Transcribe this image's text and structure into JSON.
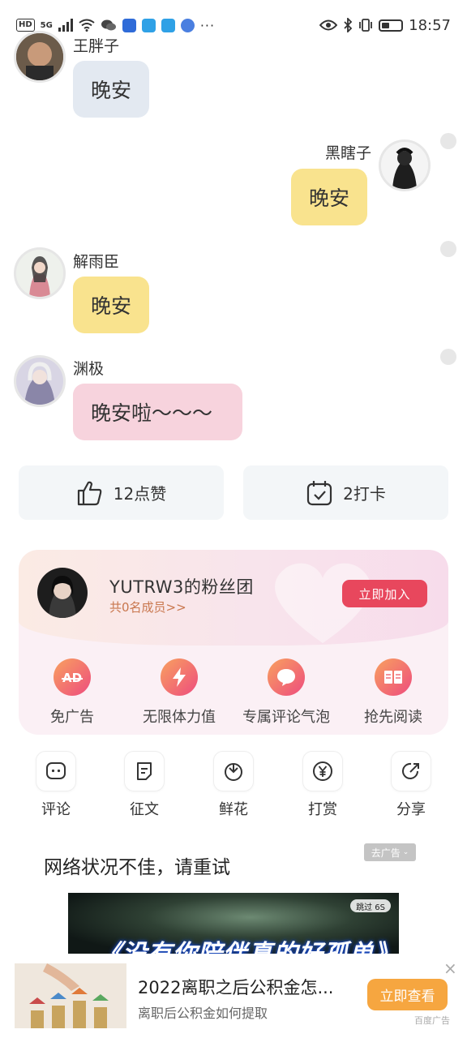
{
  "status_bar": {
    "left_chips": [
      "HD",
      "5G"
    ],
    "time": "18:57"
  },
  "chat": {
    "messages": [
      {
        "sender": "王胖子",
        "text": "晚安",
        "side": "left",
        "bubble_color": "#e3e9f1"
      },
      {
        "sender": "黑瞎子",
        "text": "晚安",
        "side": "right",
        "bubble_color": "#f9e38e"
      },
      {
        "sender": "解雨臣",
        "text": "晚安",
        "side": "left",
        "bubble_color": "#f9e38e"
      },
      {
        "sender": "渊极",
        "text": "晚安啦～～～",
        "side": "left",
        "bubble_color": "#f7d3dd"
      }
    ]
  },
  "actions": {
    "like_label": "12点赞",
    "checkin_label": "2打卡"
  },
  "fan_club": {
    "title": "YUTRW3的粉丝团",
    "members": "共0名成员>>",
    "join_label": "立即加入",
    "perks": [
      {
        "label": "免广告",
        "icon": "ad-free-icon"
      },
      {
        "label": "无限体力值",
        "icon": "lightning-icon"
      },
      {
        "label": "专属评论气泡",
        "icon": "chat-bubble-icon"
      },
      {
        "label": "抢先阅读",
        "icon": "book-icon"
      }
    ]
  },
  "toolbar": {
    "items": [
      {
        "label": "评论",
        "icon": "comment-icon"
      },
      {
        "label": "征文",
        "icon": "essay-icon"
      },
      {
        "label": "鲜花",
        "icon": "flower-icon"
      },
      {
        "label": "打赏",
        "icon": "yen-icon"
      },
      {
        "label": "分享",
        "icon": "share-icon"
      }
    ]
  },
  "ad": {
    "network_message": "网络状况不佳，请重试",
    "remove_ad_label": "去广告",
    "skip_label": "跳过 6S",
    "video_title": "《没有你陪伴真的好孤单》",
    "banner_title": "2022离职之后公积金怎...",
    "banner_subtitle": "离职后公积金如何提取",
    "banner_button": "立即查看",
    "banner_source": "百度广告",
    "banner_close": "×",
    "accent_color": "#f6a640"
  },
  "colors": {
    "join_button": "#e8475d",
    "perk_gradient_start": "#f8a15f",
    "perk_gradient_end": "#ee4c7e"
  }
}
